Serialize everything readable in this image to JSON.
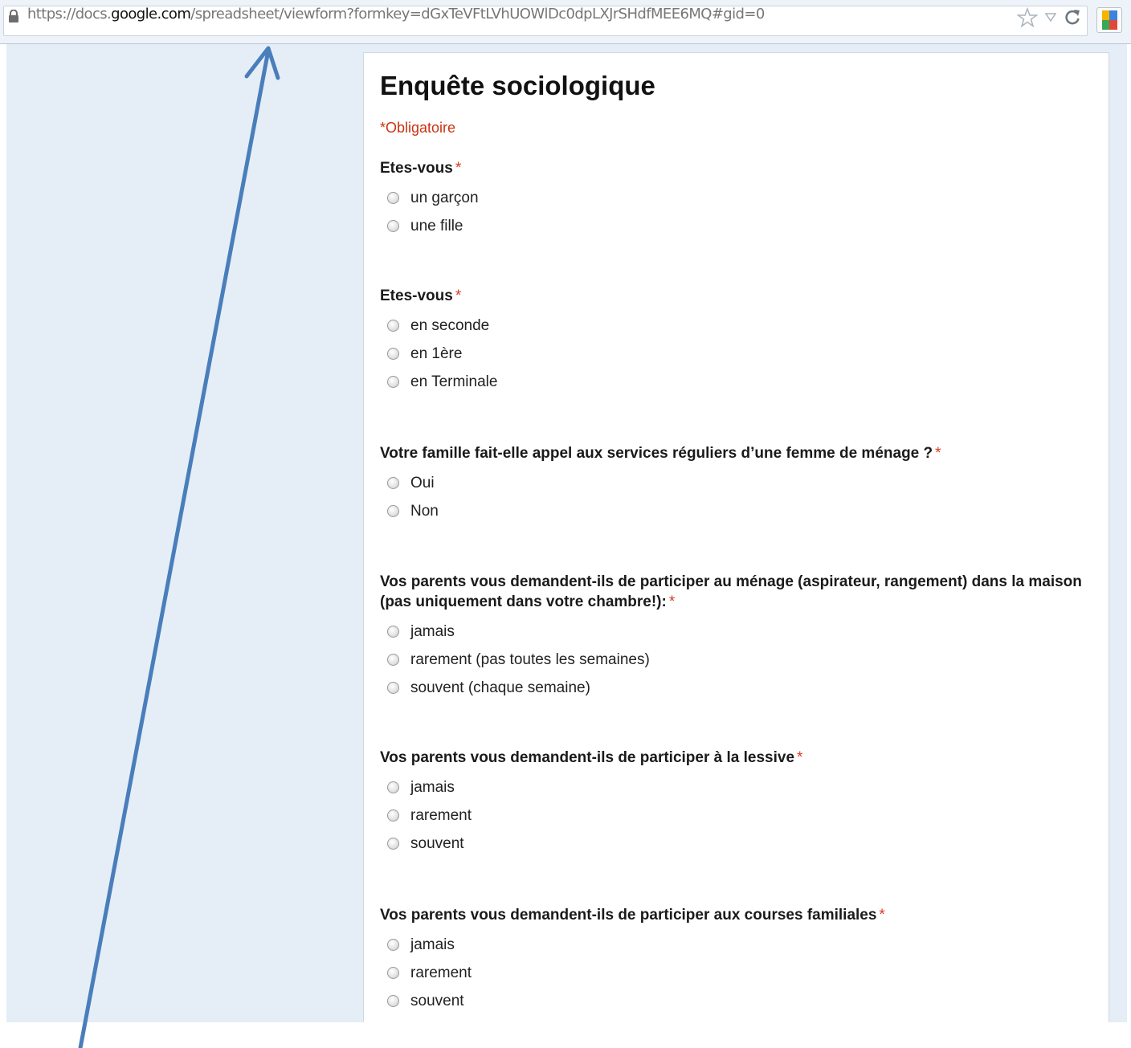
{
  "browser": {
    "url_prefix": "https://docs.",
    "url_domain": "google.com",
    "url_path": "/spreadsheet/viewform?formkey=dGxTeVFtLVhUOWlDc0dpLXJrSHdfMEE6MQ#gid=0"
  },
  "form": {
    "title": "Enquête sociologique",
    "required_note": "*Obligatoire",
    "questions": [
      {
        "label": "Etes-vous",
        "options": [
          "un garçon",
          "une fille"
        ]
      },
      {
        "label": "Etes-vous",
        "options": [
          "en seconde",
          "en 1ère",
          "en Terminale"
        ]
      },
      {
        "label": "Votre famille fait-elle appel aux services réguliers d’une femme de ménage ?",
        "options": [
          "Oui",
          "Non"
        ]
      },
      {
        "label": "Vos parents vous demandent-ils de participer au ménage (aspirateur, rangement) dans la maison (pas uniquement dans votre chambre!):",
        "options": [
          "jamais",
          "rarement (pas toutes les semaines)",
          "souvent (chaque semaine)"
        ]
      },
      {
        "label": "Vos parents vous demandent-ils de participer à la lessive",
        "options": [
          "jamais",
          "rarement",
          "souvent"
        ]
      },
      {
        "label": "Vos parents vous demandent-ils de participer aux courses familiales",
        "options": [
          "jamais",
          "rarement",
          "souvent"
        ]
      }
    ],
    "required_marker": "*"
  },
  "annotation": {
    "arrow_color": "#4a7ebb"
  }
}
